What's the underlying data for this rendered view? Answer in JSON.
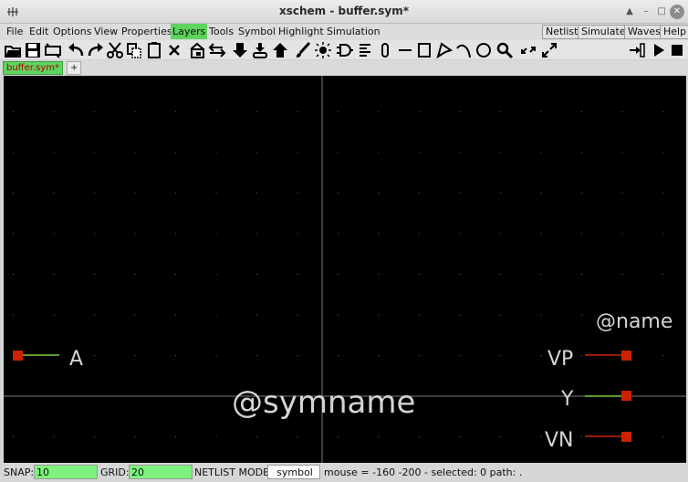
{
  "window": {
    "title": "xschem - buffer.sym*"
  },
  "menubar": {
    "items": [
      "File",
      "Edit",
      "Options",
      "View",
      "Properties",
      "Layers",
      "Tools",
      "Symbol",
      "Highlight",
      "Simulation"
    ],
    "active": "Layers",
    "right_buttons": [
      "Netlist",
      "Simulate",
      "Waves",
      "Help"
    ]
  },
  "toolbar": {
    "icons": [
      "open-icon",
      "save-icon",
      "reload-icon",
      "undo-icon",
      "redo-icon",
      "cut-icon",
      "copy-icon",
      "duplicate-icon",
      "delete-icon",
      "insert-symbol-icon",
      "swap-icon",
      "push-down-icon",
      "descend-icon",
      "go-up-icon",
      "brush-icon",
      "light-icon",
      "logic-gate-icon",
      "list-icon",
      "pin-icon",
      "line-icon",
      "rect-icon",
      "polygon-icon",
      "arc-icon",
      "circle-icon",
      "zoom-icon",
      "zoom-fit-icon",
      "zoom-full-icon",
      "netlist-arrow-icon",
      "play-icon",
      "stop-icon"
    ]
  },
  "tabs": {
    "active": "buffer.sym*",
    "add": "+"
  },
  "canvas": {
    "background": "#000000",
    "grid_color": "#5a5a5a",
    "axis_color": "#7a7a7a",
    "pin_color": "#cc2200",
    "wire_red": "#cc2200",
    "wire_green": "#7ccd3c",
    "labels": {
      "name": "@name",
      "symname": "@symname",
      "A": "A",
      "VP": "VP",
      "Y": "Y",
      "VN": "VN"
    }
  },
  "statusbar": {
    "snap_label": "SNAP:",
    "snap_value": "10",
    "grid_label": "GRID:",
    "grid_value": "20",
    "netlist_mode_label": "NETLIST MODE:",
    "netlist_mode_value": "symbol",
    "mouse_info": "mouse = -160 -200 - selected: 0 path: ."
  }
}
